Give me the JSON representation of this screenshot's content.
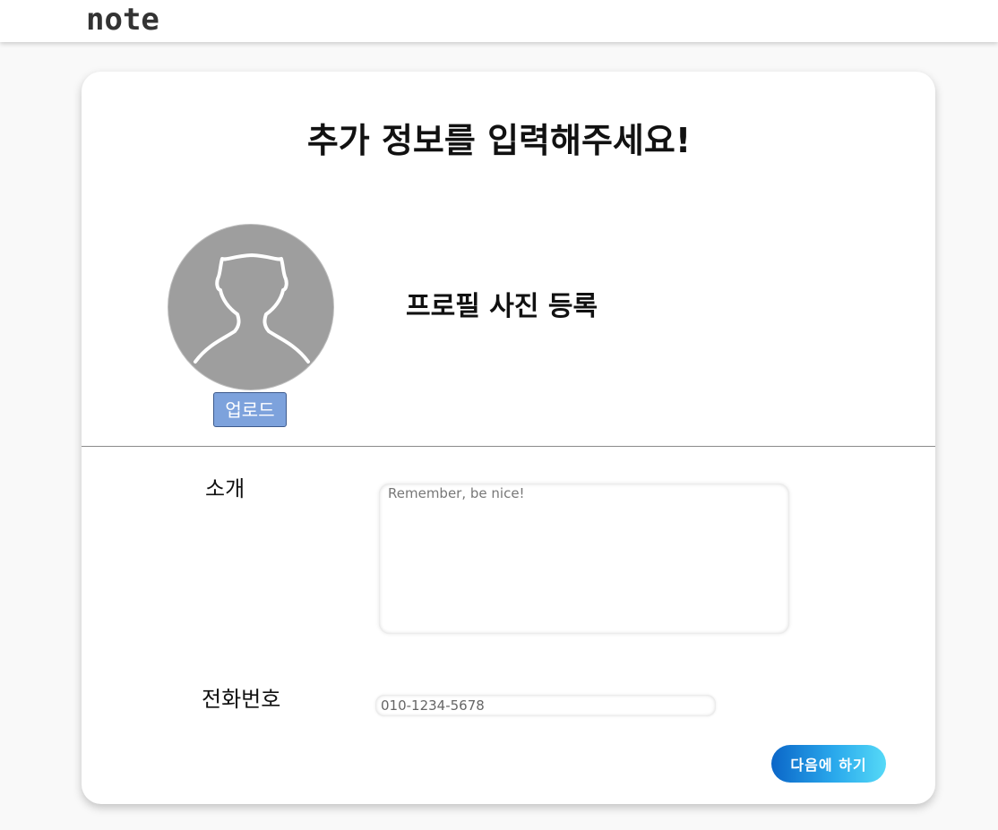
{
  "header": {
    "logo": "note"
  },
  "form": {
    "title": "추가 정보를 입력해주세요!",
    "profile": {
      "label": "프로필 사진 등록",
      "upload_label": "업로드",
      "avatar_icon": "user-silhouette-icon"
    },
    "intro": {
      "label": "소개",
      "value": "",
      "placeholder": "Remember, be nice!"
    },
    "phone": {
      "label": "전화번호",
      "value": "",
      "placeholder": "010-1234-5678"
    },
    "skip_label": "다음에 하기"
  },
  "colors": {
    "upload_button": "#7da2dc",
    "avatar_background": "#9e9e9e",
    "skip_gradient_start": "#0b66c8",
    "skip_gradient_end": "#55d9f7"
  }
}
